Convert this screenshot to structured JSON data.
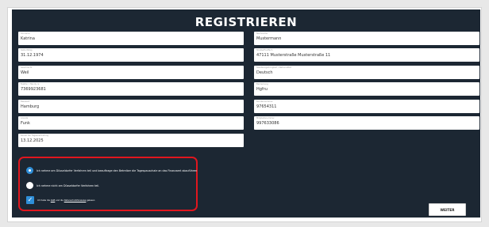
{
  "page": {
    "title": "REGISTRIEREN",
    "submit_label": "WEITER"
  },
  "fields": [
    {
      "label": "Vorname",
      "value": "Katrina"
    },
    {
      "label": "Nachname",
      "value": "Mustermann"
    },
    {
      "label": "Geburtstag",
      "value": "31.12.1974"
    },
    {
      "label": "Straße/Postfach",
      "value": "47111 Musterstraße Musterstraße 11"
    },
    {
      "label": "Geschlecht",
      "value": "Weil"
    },
    {
      "label": "Staatsangehörigkeit / Nationalität",
      "value": "Deutsch"
    },
    {
      "label": "Telefon / Handy nr.",
      "value": "7369923681"
    },
    {
      "label": "Bemerkung",
      "value": "Hgfru"
    },
    {
      "label": "Passwort",
      "value": "Hamburg"
    },
    {
      "label": "Kundennummer",
      "value": "97654311"
    },
    {
      "label": "Anrede",
      "value": "Funk"
    },
    {
      "label": "Mitgliedsnummer",
      "value": "997633086"
    },
    {
      "label": "Kürzel der Tagesvertretung",
      "value": "13.12.2025"
    }
  ],
  "consent": {
    "option1": "Ich nehme am Düsseldorfer Verfahren teil und beauftrage den Betreiber die Tagespauschale an das Finanzamt abzuführen",
    "option2": "Ich nehme nicht am Düsseldorfer Verfahren teil.",
    "terms_prefix": "Ich habe die",
    "terms_agb": "AGB",
    "terms_middle": "und die",
    "terms_privacy": "Datenschutzhinweise",
    "terms_suffix": "gelesen"
  },
  "colors": {
    "panel": "#1c2733",
    "accent": "#2f8fd8",
    "highlight": "#e0161e"
  }
}
